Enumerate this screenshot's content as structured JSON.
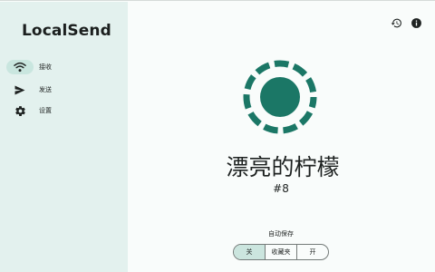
{
  "app": {
    "title": "LocalSend"
  },
  "sidebar": {
    "items": [
      {
        "label": "接收",
        "icon": "wifi-icon",
        "active": true
      },
      {
        "label": "发送",
        "icon": "send-icon",
        "active": false
      },
      {
        "label": "设置",
        "icon": "gear-icon",
        "active": false
      }
    ]
  },
  "header": {
    "icons": [
      "history-icon",
      "info-icon"
    ]
  },
  "main": {
    "device_name": "漂亮的柠檬",
    "device_id": "#8",
    "auto_save": {
      "label": "自动保存",
      "options": [
        "关",
        "收藏夹",
        "开"
      ],
      "selected": "关"
    }
  },
  "colors": {
    "accent": "#1b7766",
    "sidebar_bg": "#e3f1ee",
    "nav_active_bg": "#c9e6df",
    "segment_selected_bg": "#cbe5de"
  }
}
